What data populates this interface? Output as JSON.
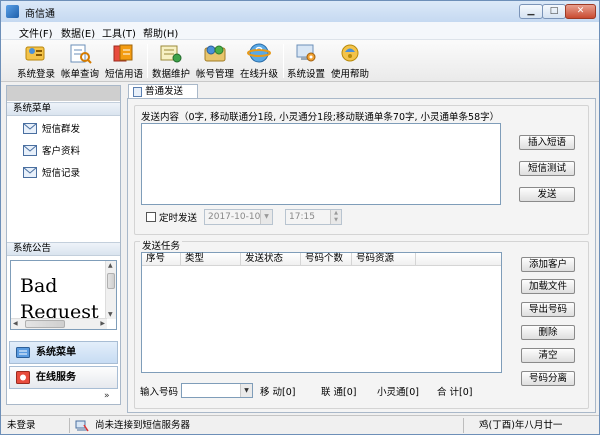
{
  "window": {
    "title": "商信通"
  },
  "menu": {
    "items": [
      "文件(F)",
      "数据(E)",
      "工具(T)",
      "帮助(H)"
    ]
  },
  "toolbar": {
    "items": [
      {
        "label": "系统登录",
        "icon": "login-icon"
      },
      {
        "label": "帐单查询",
        "icon": "bill-query-icon"
      },
      {
        "label": "短信用语",
        "icon": "sms-phrases-icon"
      },
      {
        "label": "数据维护",
        "icon": "data-maintenance-icon"
      },
      {
        "label": "帐号管理",
        "icon": "account-management-icon"
      },
      {
        "label": "在线升级",
        "icon": "online-upgrade-icon"
      },
      {
        "label": "系统设置",
        "icon": "settings-icon"
      },
      {
        "label": "使用帮助",
        "icon": "help-icon"
      }
    ]
  },
  "sidebar": {
    "menu_title": "系统菜单",
    "items": [
      {
        "label": "短信群发",
        "icon": "sms-broadcast-icon"
      },
      {
        "label": "客户资料",
        "icon": "customer-data-icon"
      },
      {
        "label": "短信记录",
        "icon": "sms-record-icon"
      }
    ],
    "notice_title": "系统公告",
    "notice_text_line1": "Bad",
    "notice_text_line2": "Request",
    "nav": [
      {
        "label": "系统菜单",
        "icon": "system-menu-icon",
        "active": true
      },
      {
        "label": "在线服务",
        "icon": "online-service-icon",
        "active": false
      }
    ],
    "expand_glyph": "»"
  },
  "tab": {
    "label": "普通发送"
  },
  "send": {
    "content_label": "发送内容（0字, 移动联通分1段, 小灵通分1段;移动联通单条70字, 小灵通单条58字）",
    "buttons": [
      "插入短语",
      "短信测试",
      "发送"
    ],
    "scheduled_label": "定时发送",
    "date_value": "2017-10-10",
    "time_value": "17:15"
  },
  "task": {
    "label": "发送任务",
    "columns": [
      "序号",
      "类型",
      "发送状态",
      "号码个数",
      "号码资源"
    ],
    "rows": [],
    "buttons": [
      "添加客户",
      "加载文件",
      "导出号码",
      "删除",
      "清空",
      "号码分离"
    ],
    "number_input_label": "输入号码",
    "stats": [
      "移 动[0]",
      "联 通[0]",
      "小灵通[0]",
      "合 计[0]"
    ]
  },
  "status": {
    "login_state": "未登录",
    "connection": "尚未连接到短信服务器",
    "date": "鸡(丁酉)年八月廿一"
  },
  "colors": {
    "accent": "#6d8fb8",
    "close_button": "#c94b31",
    "panel_border": "#a9b8c9"
  }
}
